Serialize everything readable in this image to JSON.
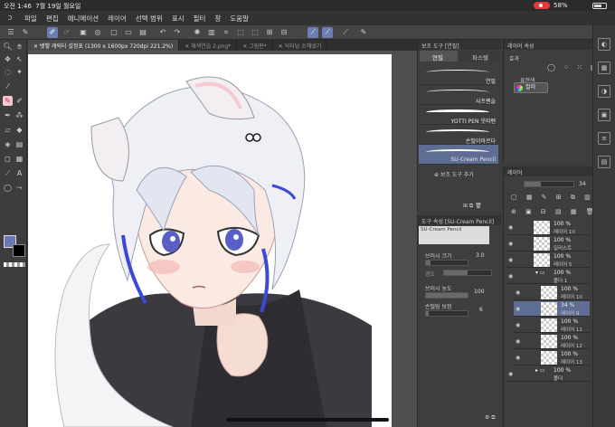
{
  "status": {
    "time": "오전 1:46",
    "date": "7월 19일 월요일",
    "battery": "58%"
  },
  "menu": {
    "items": [
      "파일",
      "편집",
      "애니메이션",
      "레이어",
      "선택 범위",
      "표시",
      "필터",
      "창",
      "도움말"
    ]
  },
  "tabs": [
    {
      "label": "✕ 뱃헿 캐릭터 설정표 (1300 x 1600px 720dpi 221.2%)",
      "active": true
    },
    {
      "label": "✕ 채색연습 2.png*",
      "active": false
    },
    {
      "label": "✕ 그림판*",
      "active": false
    },
    {
      "label": "✕ 닥터남 소해냈기",
      "active": false
    }
  ],
  "subtool": {
    "panel_title": "보조 도구 [연필]",
    "tab_pencil": "연필",
    "tab_pastel": "파스텔",
    "brushes": [
      {
        "name": "연필",
        "selected": false
      },
      {
        "name": "샤프펜슬",
        "selected": false
      },
      {
        "name": "YOTTI PEN 웃따펜",
        "selected": false
      },
      {
        "name": "손떨이마르다",
        "selected": false
      },
      {
        "name": "SU-Cream Pencil",
        "selected": true
      }
    ],
    "add_label": "보조 도구 추가"
  },
  "tool_props": {
    "panel_title": "도구 속성 [SU-Cream Pencil]",
    "preview_name": "SU-Cream Pencil",
    "brush_size_label": "브러시 크기",
    "brush_size_value": "3.0",
    "hardness_label": "경도",
    "density_label": "브러시 농도",
    "density_value": "100",
    "stabilization_label": "손떨림 보정",
    "stabilization_value": "6"
  },
  "layer_props": {
    "panel_title": "레이어 속성",
    "effect_label": "효과",
    "expression_label": "표현색",
    "expression_value": "컬러"
  },
  "layers": {
    "panel_title": "레이어",
    "opacity_value": "34",
    "items": [
      {
        "pct": "100 %",
        "name": "레이어 10",
        "selected": false,
        "folder": false
      },
      {
        "pct": "100 %",
        "name": "일러스트",
        "selected": false,
        "folder": false
      },
      {
        "pct": "100 %",
        "name": "레이어 5",
        "selected": false,
        "folder": false
      },
      {
        "pct": "100 %",
        "name": "폴더 1",
        "selected": false,
        "folder": true
      },
      {
        "pct": "100 %",
        "name": "레이어 10",
        "selected": false,
        "folder": false
      },
      {
        "pct": "34 %",
        "name": "레이어 9",
        "selected": true,
        "folder": false
      },
      {
        "pct": "100 %",
        "name": "레이어 11",
        "selected": false,
        "folder": false
      },
      {
        "pct": "100 %",
        "name": "레이어 12",
        "selected": false,
        "folder": false
      },
      {
        "pct": "100 %",
        "name": "레이어 13",
        "selected": false,
        "folder": false
      },
      {
        "pct": "100 %",
        "name": "폴더",
        "selected": false,
        "folder": true
      }
    ]
  },
  "colors": {
    "main": "#6a78b8",
    "sub": "#000000",
    "accent": "#5e6d93"
  }
}
